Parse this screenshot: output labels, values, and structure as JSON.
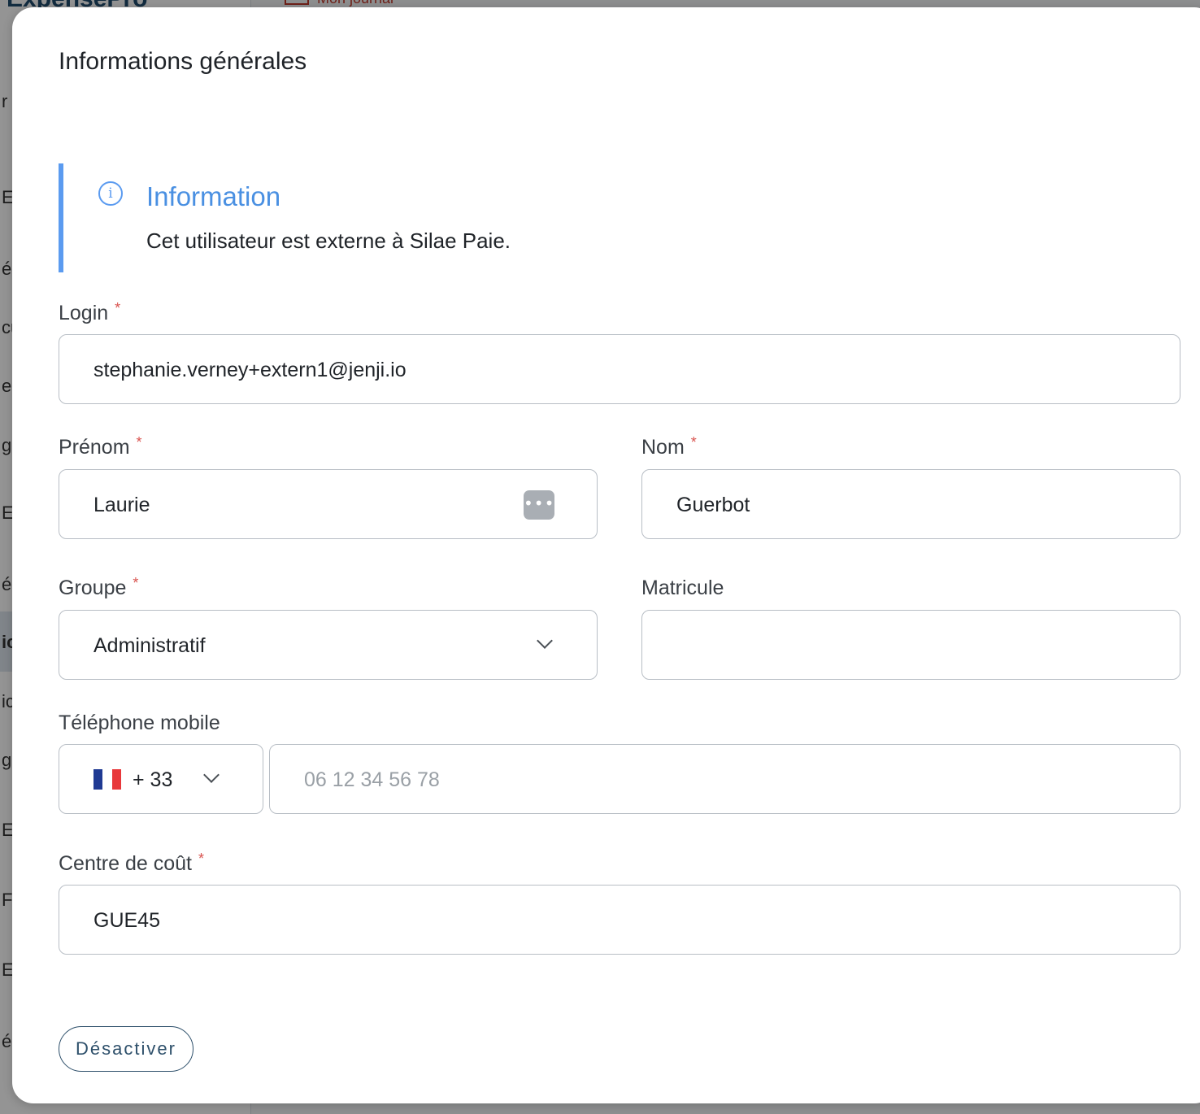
{
  "background": {
    "brand": "ExpensePro",
    "top_link": "Mon journal",
    "nav_fragments": [
      "r",
      "ES",
      "én",
      "cu",
      "es",
      "gr",
      "ES",
      "én",
      "ic",
      "ic",
      "gr",
      "ES",
      "F",
      "EN",
      "én"
    ]
  },
  "modal": {
    "title": "Informations générales",
    "info": {
      "icon": "info-icon",
      "icon_glyph": "i",
      "title": "Information",
      "text": "Cet utilisateur est externe à Silae Paie."
    },
    "fields": {
      "login": {
        "label": "Login",
        "required_mark": "*",
        "value": "stephanie.verney+extern1@jenji.io"
      },
      "prenom": {
        "label": "Prénom",
        "required_mark": "*",
        "value": "Laurie",
        "autofill_icon": "keychain-icon",
        "autofill_glyph": "•••|"
      },
      "nom": {
        "label": "Nom",
        "required_mark": "*",
        "value": "Guerbot"
      },
      "groupe": {
        "label": "Groupe",
        "required_mark": "*",
        "value": "Administratif",
        "icon": "chevron-down-icon"
      },
      "matricule": {
        "label": "Matricule",
        "value": ""
      },
      "telephone": {
        "label": "Téléphone mobile",
        "country_flag": "france-flag-icon",
        "flag_colors": [
          "#1f3a93",
          "#ffffff",
          "#e8383b"
        ],
        "country_code": "+ 33",
        "value": "",
        "placeholder": "06 12 34 56 78"
      },
      "centre_cout": {
        "label": "Centre de coût",
        "required_mark": "*",
        "value": "GUE45"
      }
    },
    "deactivate_label": "Désactiver"
  }
}
